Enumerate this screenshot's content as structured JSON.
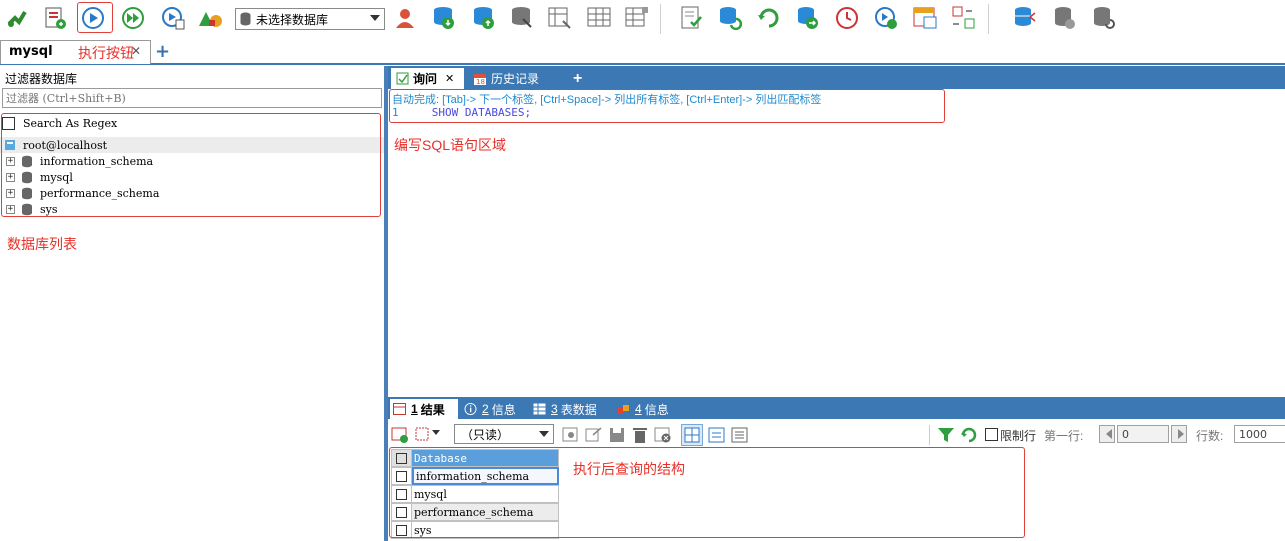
{
  "toolbar": {
    "database_select": "未选择数据库"
  },
  "connection_tab": {
    "label": "mysql",
    "close": "✕",
    "add": "+"
  },
  "annotations": {
    "execute_button": "执行按钮",
    "sql_area": "编写SQL语句区域",
    "db_list": "数据库列表",
    "result": "执行后查询的结构"
  },
  "left_panel": {
    "title": "过滤器数据库",
    "filter_placeholder": "过滤器 (Ctrl+Shift+B)",
    "regex_label": "Search As Regex",
    "root": "root@localhost",
    "databases": [
      "information_schema",
      "mysql",
      "performance_schema",
      "sys"
    ]
  },
  "editor": {
    "tabs": [
      {
        "label": "询问"
      },
      {
        "label": "历史记录"
      }
    ],
    "add_tab": "+",
    "autocomplete": "自动完成: [Tab]-> 下一个标签, [Ctrl+Space]-> 列出所有标签, [Ctrl+Enter]-> 列出匹配标签",
    "line_number": "1",
    "sql": "SHOW DATABASES;"
  },
  "results": {
    "tabs": [
      {
        "num": "1",
        "label": "结果"
      },
      {
        "num": "2",
        "label": "信息"
      },
      {
        "num": "3",
        "label": "表数据"
      },
      {
        "num": "4",
        "label": "信息"
      }
    ],
    "readonly_select": "（只读）",
    "limit_label": "限制行",
    "first_row_label": "第一行:",
    "first_row_value": "0",
    "row_count_label": "行数:",
    "row_count_value": "1000",
    "column": "Database",
    "rows": [
      "information_schema",
      "mysql",
      "performance_schema",
      "sys"
    ]
  },
  "colors": {
    "accent_blue": "#3c78b4",
    "annotation_red": "#e8302a",
    "grid_header": "#5a9fdc"
  }
}
